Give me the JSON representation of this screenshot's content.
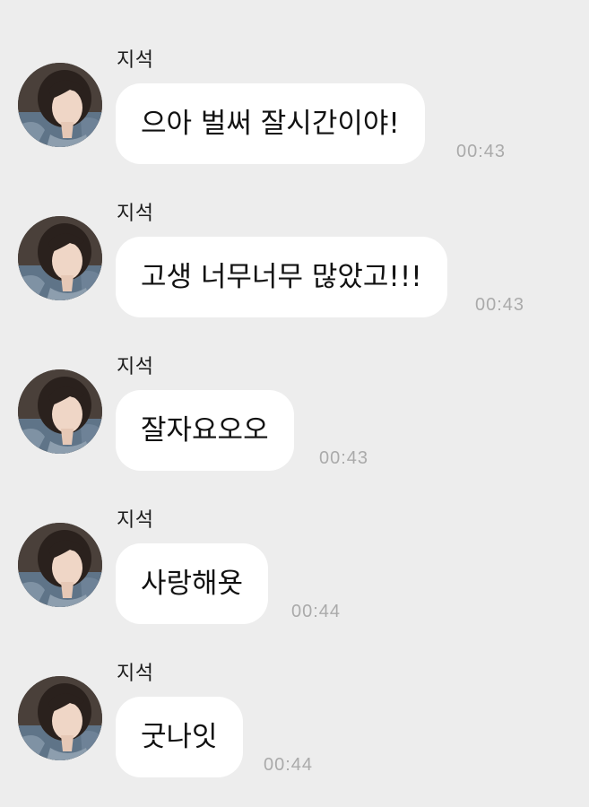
{
  "messages": [
    {
      "sender": "지석",
      "text": "으아 벌써 잘시간이야!",
      "time": "00:43"
    },
    {
      "sender": "지석",
      "text": "고생 너무너무 많았고!!!",
      "time": "00:43"
    },
    {
      "sender": "지석",
      "text": "잘자요오오",
      "time": "00:43"
    },
    {
      "sender": "지석",
      "text": "사랑해욧",
      "time": "00:44"
    },
    {
      "sender": "지석",
      "text": "굿나잇",
      "time": "00:44"
    }
  ]
}
